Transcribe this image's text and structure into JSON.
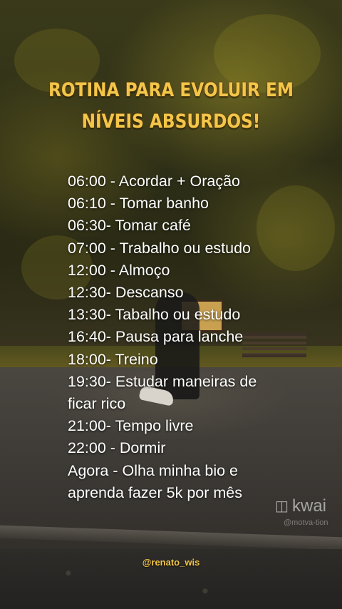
{
  "title": {
    "line1": "ROTINA PARA EVOLUIR EM",
    "line2": "NÍVEIS ABSURDOS!"
  },
  "routine": [
    "06:00 - Acordar + Oração",
    "06:10 - Tomar banho",
    "06:30- Tomar café",
    "07:00 - Trabalho ou estudo",
    "12:00 - Almoço",
    "12:30- Descanso",
    "13:30- Tabalho ou estudo",
    "16:40- Pausa para lanche",
    "18:00- Treino",
    "19:30- Estudar maneiras de",
    "ficar rico",
    "21:00- Tempo livre",
    "22:00 - Dormir",
    "Agora - Olha minha bio e",
    "aprenda fazer 5k por mês"
  ],
  "watermark": {
    "brand": "kwai",
    "handle": "@motva-tion"
  },
  "credit": "@renato_wis",
  "colors": {
    "title": "#f3c64a",
    "body_text": "#ffffff"
  }
}
